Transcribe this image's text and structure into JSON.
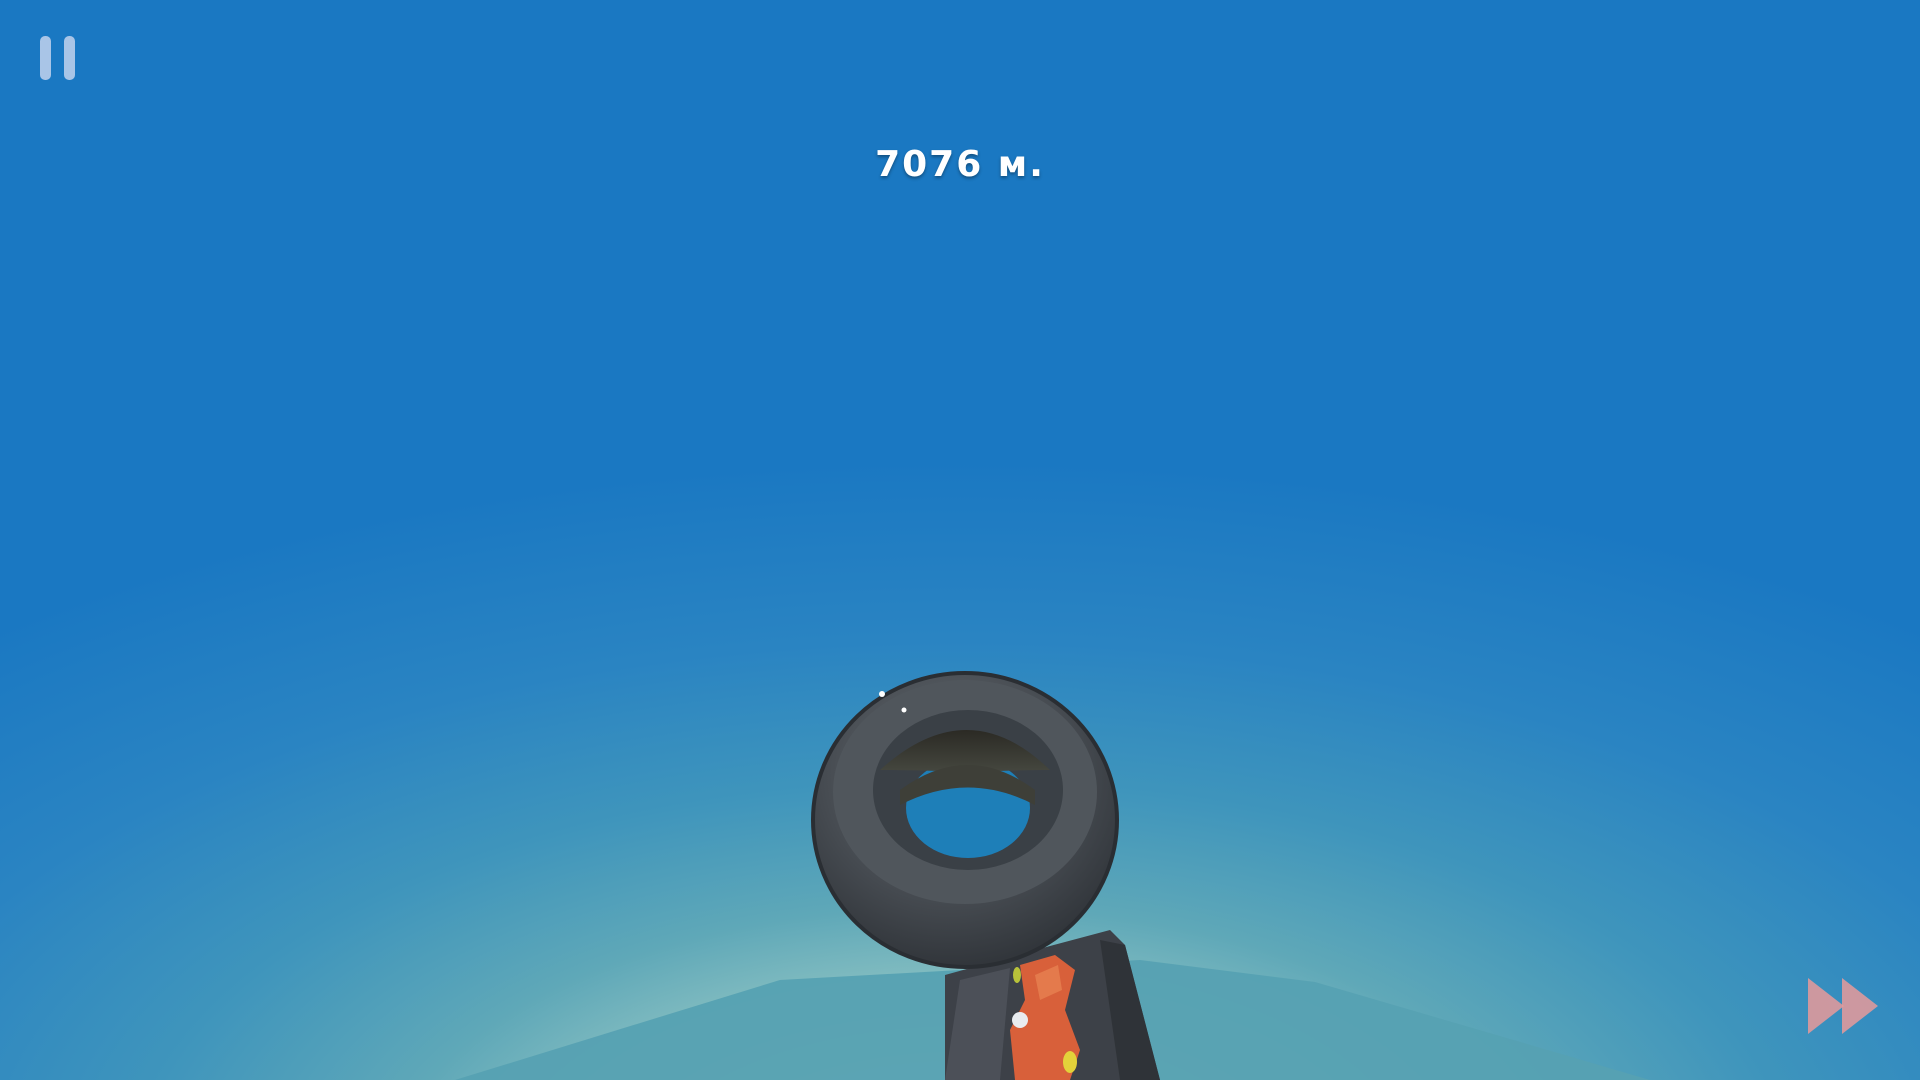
{
  "hud": {
    "distance_text": "7076 м."
  },
  "controls": {
    "pause_icon": "pause-icon",
    "fast_forward_icon": "fast-forward-icon"
  },
  "colors": {
    "sky_top": "#1a78c2",
    "sky_horizon": "#d3ead9",
    "platform": "#56a1b2",
    "tire": "#4a4f55",
    "lava": "#d8603a",
    "fast_forward": "#e89a9a"
  }
}
